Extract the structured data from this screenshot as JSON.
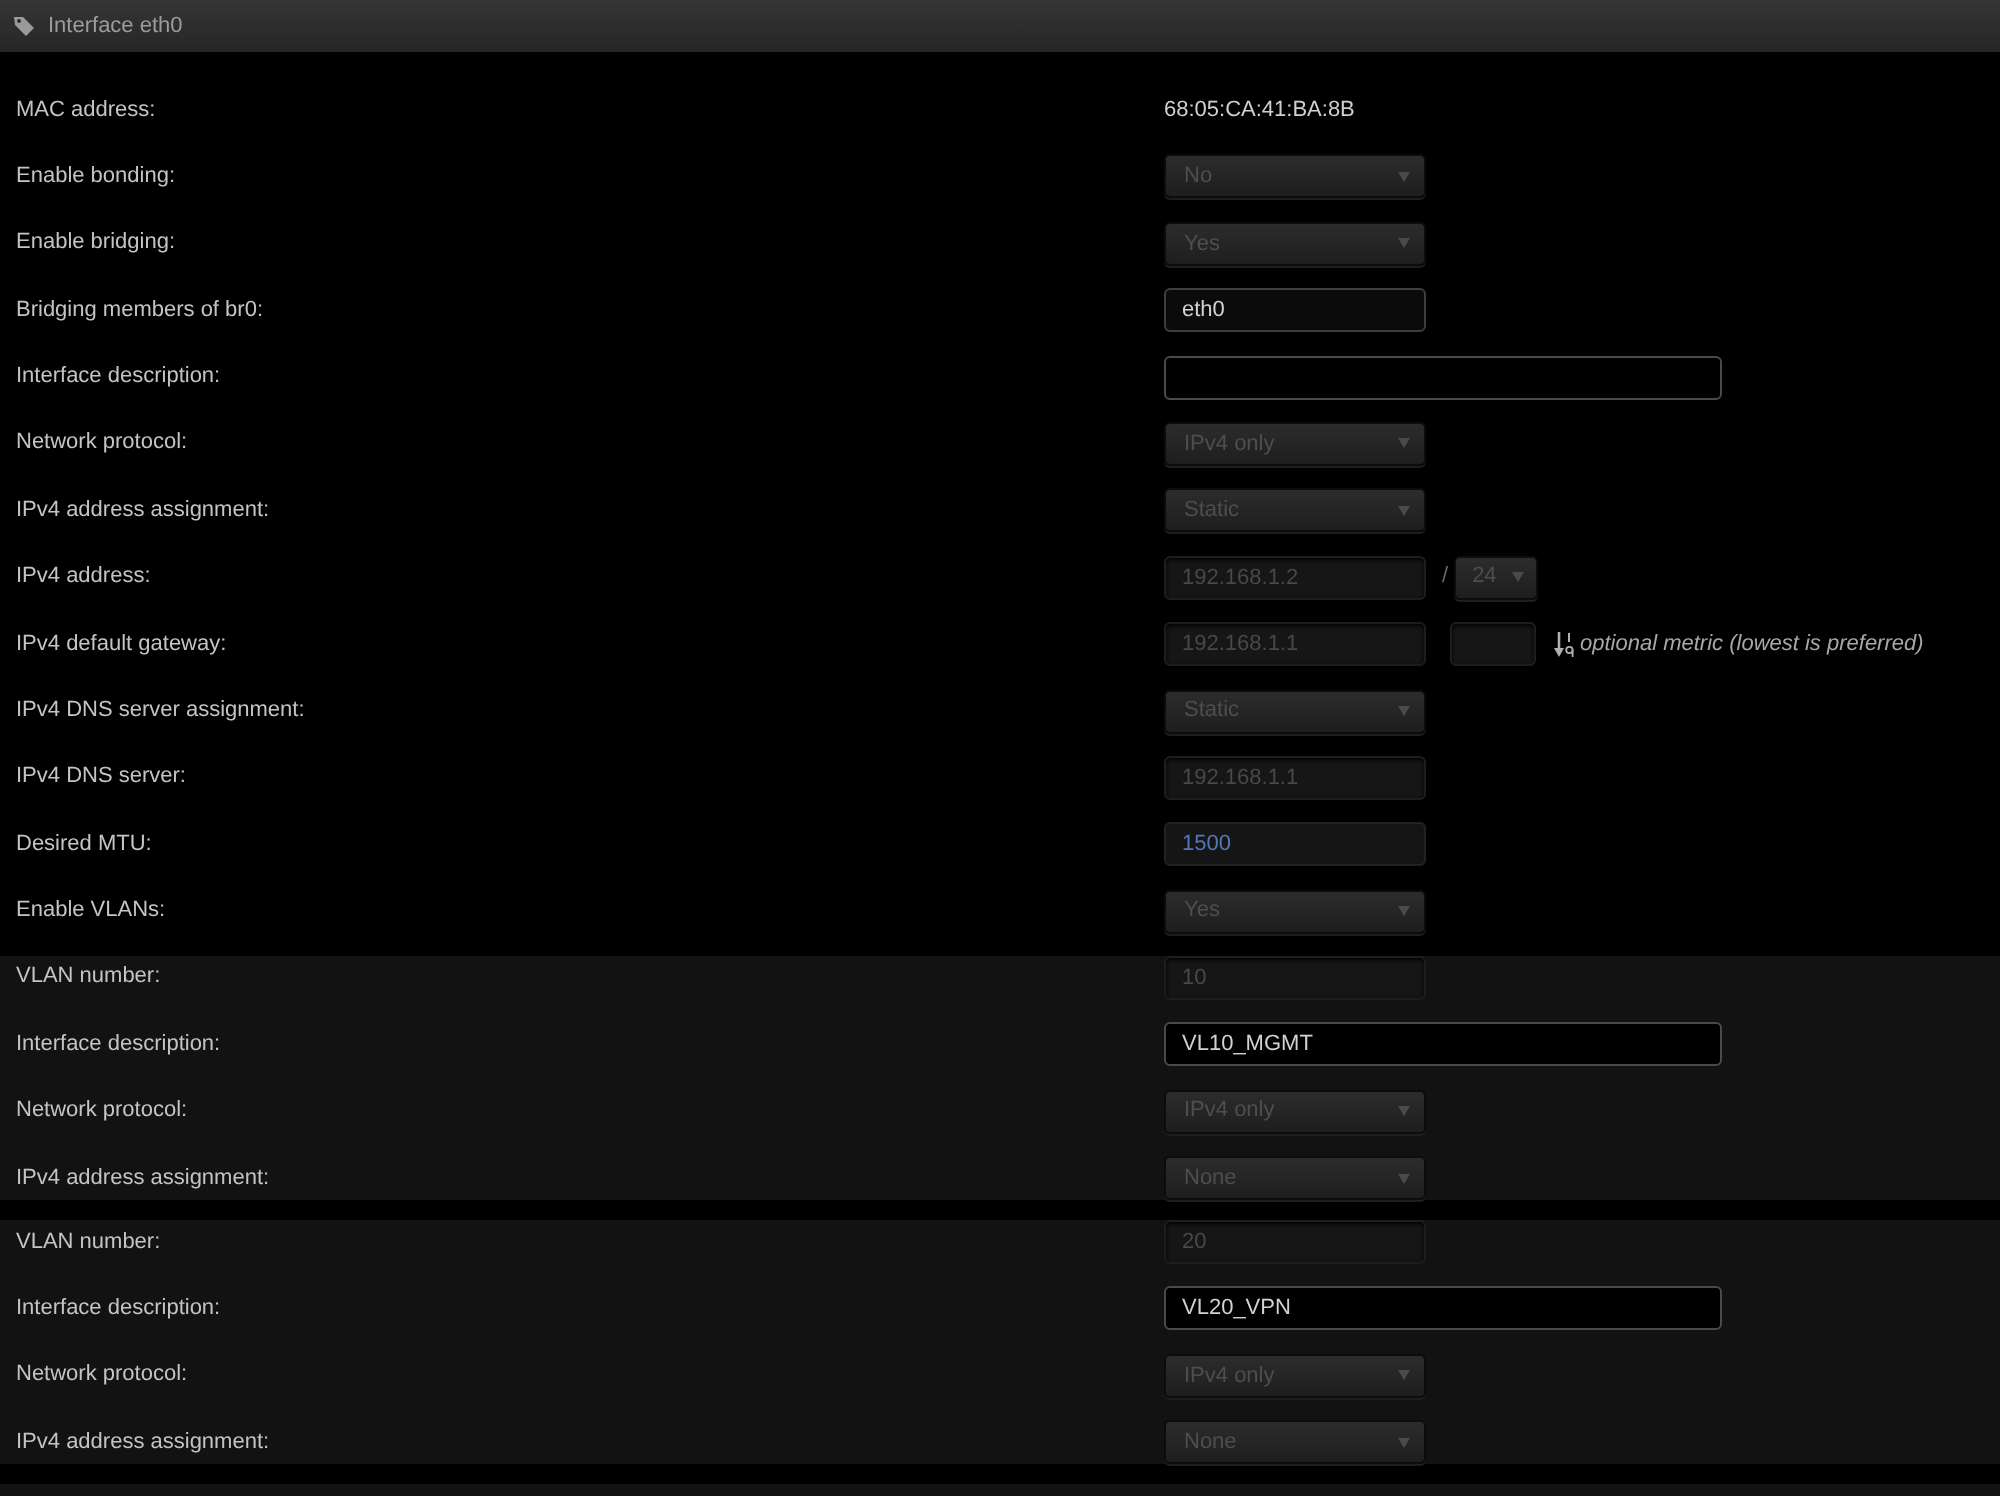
{
  "header": {
    "title": "Interface eth0"
  },
  "fields": [
    {
      "label": "MAC address:",
      "kind": "text",
      "value": "68:05:CA:41:BA:8B"
    },
    {
      "label": "Enable bonding:",
      "kind": "select",
      "value": "No",
      "disabled": true
    },
    {
      "label": "Enable bridging:",
      "kind": "select",
      "value": "Yes",
      "disabled": true
    },
    {
      "label": "Bridging members of br0:",
      "kind": "input",
      "value": "eth0",
      "disabled": false,
      "modified": false
    },
    {
      "label": "Interface description:",
      "kind": "wide_input",
      "disabled": false
    },
    {
      "label": "Network protocol:",
      "kind": "select",
      "value": "IPv4 only",
      "disabled": true
    },
    {
      "label": "IPv4 address assignment:",
      "kind": "select",
      "value": "Static",
      "disabled": true
    },
    {
      "label": "IPv4 address:",
      "kind": "address",
      "value": "192.168.1.2",
      "disabled": true,
      "modified": false,
      "separator": "/",
      "prefix": {
        "value": "24",
        "disabled": true
      }
    },
    {
      "label": "IPv4 default gateway:",
      "kind": "gateway",
      "value": "192.168.1.1",
      "disabled": true,
      "modified": false,
      "metric": {
        "disabled": true
      },
      "hint": "optional metric (lowest is preferred)"
    },
    {
      "label": "IPv4 DNS server assignment:",
      "kind": "select",
      "value": "Static",
      "disabled": true
    },
    {
      "label": "IPv4 DNS server:",
      "kind": "input",
      "value": "192.168.1.1",
      "disabled": true,
      "modified": false
    },
    {
      "label": "Desired MTU:",
      "kind": "input",
      "value": "1500",
      "disabled": false,
      "modified": true
    },
    {
      "label": "Enable VLANs:",
      "kind": "select",
      "value": "Yes",
      "disabled": true
    }
  ],
  "vlans": [
    {
      "fields": [
        {
          "label": "VLAN number:",
          "kind": "input",
          "value": "10",
          "disabled": true,
          "modified": false
        },
        {
          "label": "Interface description:",
          "kind": "wide_input",
          "value": "VL10_MGMT",
          "disabled": false,
          "modified": false
        },
        {
          "label": "Network protocol:",
          "kind": "select",
          "value": "IPv4 only",
          "disabled": true
        },
        {
          "label": "IPv4 address assignment:",
          "kind": "select",
          "value": "None",
          "disabled": true
        }
      ]
    },
    {
      "fields": [
        {
          "label": "VLAN number:",
          "kind": "input",
          "value": "20",
          "disabled": true,
          "modified": false
        },
        {
          "label": "Interface description:",
          "kind": "wide_input",
          "value": "VL20_VPN",
          "disabled": false,
          "modified": false
        },
        {
          "label": "Network protocol:",
          "kind": "select",
          "value": "IPv4 only",
          "disabled": true
        },
        {
          "label": "IPv4 address assignment:",
          "kind": "select",
          "value": "None",
          "disabled": true
        }
      ]
    }
  ]
}
